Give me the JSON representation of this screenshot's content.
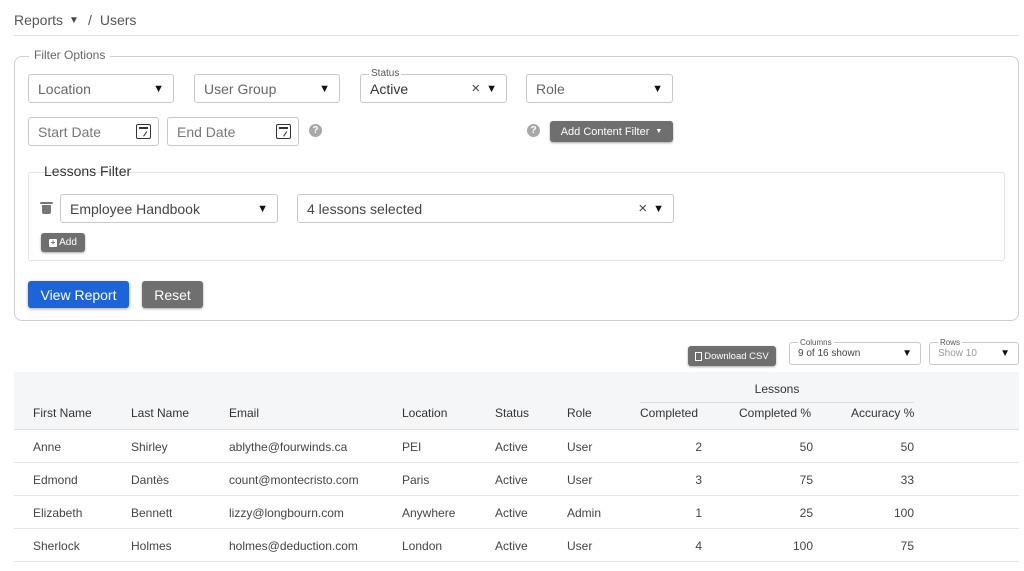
{
  "breadcrumb": {
    "parent": "Reports",
    "current": "Users",
    "separator": "/"
  },
  "filter": {
    "legend": "Filter Options",
    "location": {
      "placeholder": "Location"
    },
    "user_group": {
      "placeholder": "User Group"
    },
    "status": {
      "label": "Status",
      "value": "Active"
    },
    "role": {
      "placeholder": "Role"
    },
    "start_date": {
      "placeholder": "Start Date"
    },
    "end_date": {
      "placeholder": "End Date"
    },
    "add_content_filter": "Add Content Filter"
  },
  "lessons_filter": {
    "title": "Lessons Filter",
    "content": "Employee Handbook",
    "lessons": "4 lessons selected",
    "add_label": "Add"
  },
  "actions": {
    "view_report": "View Report",
    "reset": "Reset"
  },
  "toolbar": {
    "download_csv": "Download CSV",
    "columns_label": "Columns",
    "columns_value": "9 of 16 shown",
    "rows_label": "Rows",
    "rows_value": "Show 10"
  },
  "table": {
    "group_header": "Lessons",
    "columns": [
      "First Name",
      "Last Name",
      "Email",
      "Location",
      "Status",
      "Role",
      "Completed",
      "Completed %",
      "Accuracy %"
    ],
    "rows": [
      [
        "Anne",
        "Shirley",
        "ablythe@fourwinds.ca",
        "PEI",
        "Active",
        "User",
        "2",
        "50",
        "50"
      ],
      [
        "Edmond",
        "Dantès",
        "count@montecristo.com",
        "Paris",
        "Active",
        "User",
        "3",
        "75",
        "33"
      ],
      [
        "Elizabeth",
        "Bennett",
        "lizzy@longbourn.com",
        "Anywhere",
        "Active",
        "Admin",
        "1",
        "25",
        "100"
      ],
      [
        "Sherlock",
        "Holmes",
        "holmes@deduction.com",
        "London",
        "Active",
        "User",
        "4",
        "100",
        "75"
      ]
    ]
  },
  "colors": {
    "primary": "#1d64d8",
    "dark_button": "#6f6f6f",
    "header_bg": "#f5f6f8"
  },
  "icons": [
    "caret-down-icon",
    "calendar-icon",
    "help-icon",
    "close-icon",
    "trash-icon",
    "plus-icon",
    "document-icon"
  ]
}
